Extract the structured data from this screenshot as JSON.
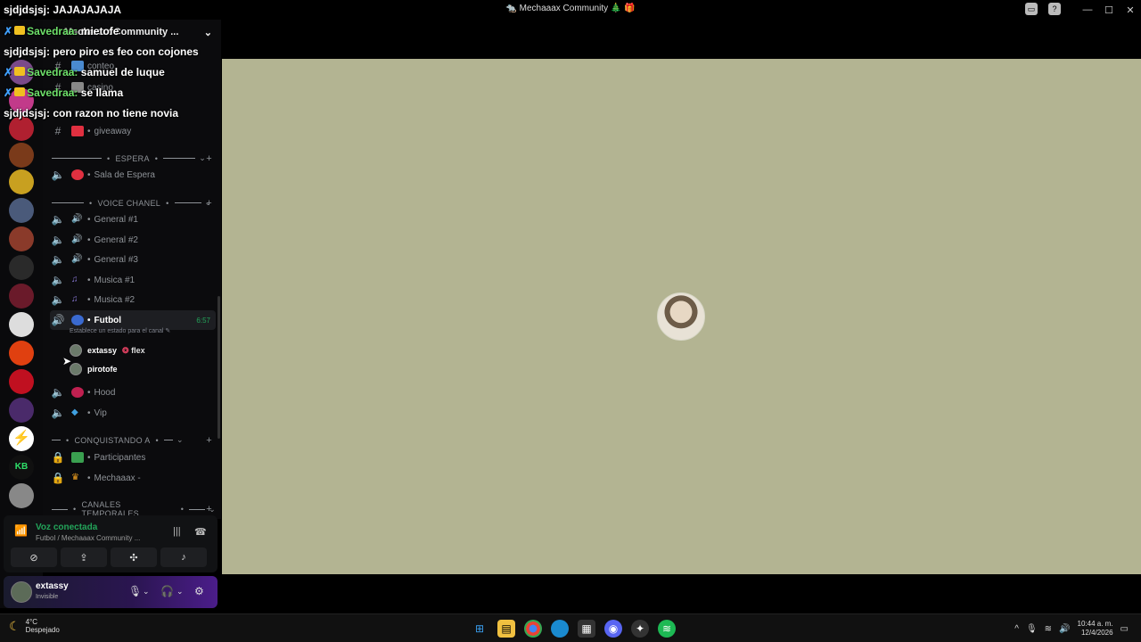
{
  "window": {
    "title": "🐀 Mechaaax Community 🎄 🎁"
  },
  "server": {
    "name": "Mechaaax Community ..."
  },
  "channels": {
    "giveaway": "giveaway",
    "cat_espera": "ESPERA",
    "sala_espera": "Sala de Espera",
    "cat_voice": "VOICE CHANEL",
    "general1": "General #1",
    "general2": "General #2",
    "general3": "General #3",
    "musica1": "Musica #1",
    "musica2": "Musica #2",
    "futbol": "Futbol",
    "futbol_timer": "6:57",
    "futbol_status": "Establece un estado para el canal",
    "hood": "Hood",
    "vip": "Vip",
    "cat_conquistando": "CONQUISTANDO A",
    "participantes": "Participantes",
    "mechaaax": "Mechaaax -",
    "cat_temporales": "CANALES TEMPORALES",
    "partial_conteo": "conteo",
    "partial_casino": "casino"
  },
  "voice_users": [
    {
      "name": "extassy",
      "badge": "flex"
    },
    {
      "name": "pirotofe",
      "badge": ""
    }
  ],
  "voice_panel": {
    "title": "Voz conectada",
    "subtitle": "Futbol / Mechaaax Community ..."
  },
  "user_panel": {
    "name": "extassy",
    "status": "Invisible"
  },
  "chat_overlay": [
    {
      "user": "sjdjdsjsj:",
      "msg": "JAJAJAJAJA"
    },
    {
      "user": "Savedraa:",
      "msg": "mietofe"
    },
    {
      "user": "sjdjdsjsj:",
      "msg": "pero piro es feo con cojones"
    },
    {
      "user": "Savedraa:",
      "msg": "samuel de luque"
    },
    {
      "user": "Savedraa:",
      "msg": "se llama"
    },
    {
      "user": "sjdjdsjsj:",
      "msg": "con razon no tiene novia"
    }
  ],
  "taskbar": {
    "temp": "4°C",
    "weather": "Despejado",
    "time": "10:44 a. m.",
    "date": "12/4/2026"
  },
  "colors": {
    "stage_bg": "#b3b492",
    "voice_green": "#23a55a",
    "chat_green": "#6ee06a"
  }
}
